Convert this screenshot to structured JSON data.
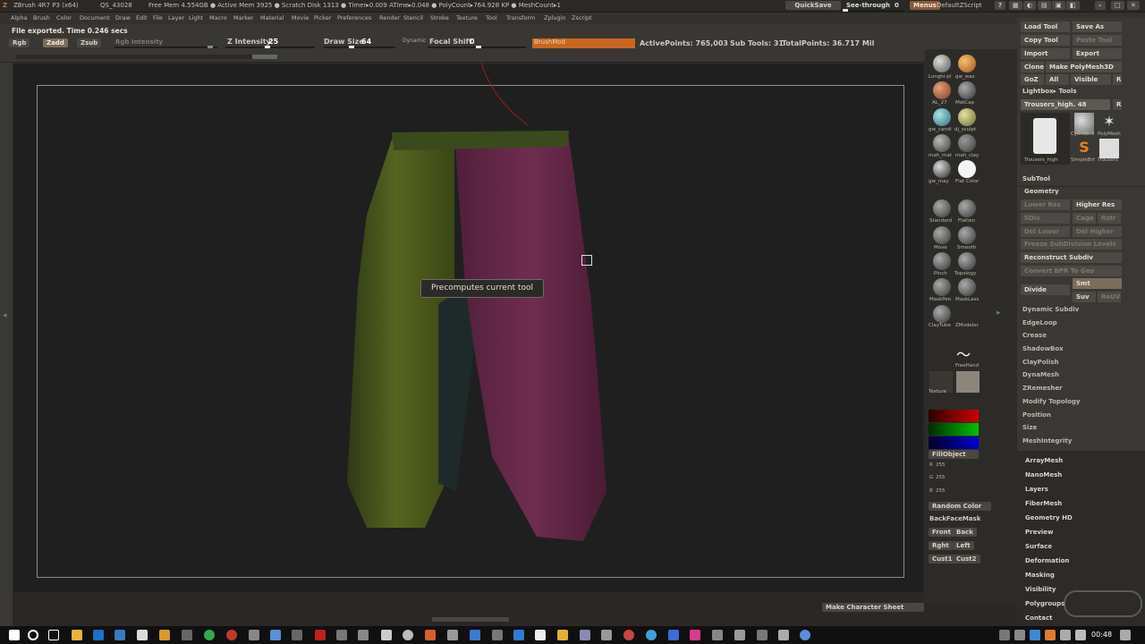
{
  "title_bar": {
    "app": "ZBrush 4R7 P3 (x64)",
    "session": "QS_43028",
    "stats": "Free Mem 4.554GB ● Active Mem 3925 ● Scratch Disk 1313 ● Timer▸0.009 ATime▸0.048 ● PolyCount▸764.928 KP ● MeshCount▸1",
    "quicksave": "QuickSave",
    "see_through": "See-through",
    "see_through_value": "0",
    "menus": "Menus",
    "script": "DefaultZScript"
  },
  "menu": [
    "Alpha",
    "Brush",
    "Color",
    "Document",
    "Draw",
    "Edit",
    "File",
    "Layer",
    "Light",
    "Macro",
    "Marker",
    "Material",
    "Movie",
    "Picker",
    "Preferences",
    "Render",
    "Stencil",
    "Stroke",
    "Texture",
    "Tool",
    "Transform",
    "Zplugin",
    "Zscript"
  ],
  "toolbar": {
    "status": "File exported. Time 0.246 secs",
    "rgb": "Rgb",
    "zadd": "Zadd",
    "zsub": "Zsub",
    "rgb_intensity": "Rgb Intensity",
    "z_intensity_label": "Z Intensity",
    "z_intensity_value": "25",
    "draw_size_label": "Draw Size",
    "draw_size_value": "64",
    "dynamic": "Dynamic",
    "focal_shift_label": "Focal Shift",
    "focal_shift_value": "0",
    "brush_mod": "BrushMod",
    "active_points": "ActivePoints: 765,003",
    "sub_tools": "Sub Tools: 31",
    "total_points": "TotalPoints: 36.717 Mil"
  },
  "canvas": {
    "tooltip": "Precomputes current tool",
    "make_character_sheet": "Make Character Sheet"
  },
  "shelf": {
    "materials": [
      "Longhi-pl",
      "gw_wax",
      "AL_27",
      "MatCap",
      "gw_candi",
      "dj_sculpt",
      "mah_mat",
      "mah_clay",
      "gw_may",
      "Flat Color"
    ],
    "brushes": [
      "Standard",
      "Flatten",
      "Move",
      "Smooth",
      "Pinch",
      "Topology",
      "MaskPen",
      "MaskLass",
      "ClayTube",
      "ZModeler",
      "FreeHand"
    ],
    "texture": "Texture",
    "fill_object": "FillObject",
    "r_label": "R",
    "r_value": "255",
    "g_label": "G",
    "g_value": "255",
    "b_label": "B",
    "b_value": "255",
    "random_color": "Random Color",
    "backface_mask": "BackFaceMask",
    "views": [
      "Front",
      "Back",
      "Rght",
      "Left",
      "Cust1",
      "Cust2"
    ]
  },
  "tool_panel": {
    "load_tool": "Load Tool",
    "save_as": "Save As",
    "copy_tool": "Copy Tool",
    "paste_tool": "Paste Tool",
    "import": "Import",
    "export": "Export",
    "clone": "Clone",
    "make_polymesh": "Make PolyMesh3D",
    "goz": "GoZ",
    "all": "All",
    "visible": "Visible",
    "r": "R",
    "lightbox_tools": "Lightbox▸ Tools",
    "current_tool": "Trousers_high. 48",
    "thumbs": [
      "Trousers_high",
      "Cylinder3",
      "PolyMesh",
      "SimpleBrt",
      "Trousers"
    ],
    "subtool": "SubTool",
    "geometry": "Geometry",
    "lower_res": "Lower Res",
    "higher_res": "Higher Res",
    "sdiv": "SDiv",
    "cage": "Cage",
    "rstr": "Rstr",
    "del_lower": "Del Lower",
    "del_higher": "Del Higher",
    "freeze": "Freeze SubDivision Levels",
    "reconstruct": "Reconstruct Subdiv",
    "convert_bpr": "Convert BPR To Geo",
    "divide": "Divide",
    "smt": "Smt",
    "suv": "Suv",
    "reuv": "ReUV",
    "sections": [
      "Dynamic Subdiv",
      "EdgeLoop",
      "Crease",
      "ShadowBox",
      "ClayPolish",
      "DynaMesh",
      "ZRemesher",
      "Modify Topology",
      "Position",
      "Size",
      "MeshIntegrity"
    ],
    "subpanels": [
      "ArrayMesh",
      "NanoMesh",
      "Layers",
      "FiberMesh",
      "Geometry HD",
      "Preview",
      "Surface",
      "Deformation",
      "Masking",
      "Visibility",
      "Polygroups",
      "Contact"
    ]
  },
  "taskbar": {
    "time": "00:48"
  }
}
